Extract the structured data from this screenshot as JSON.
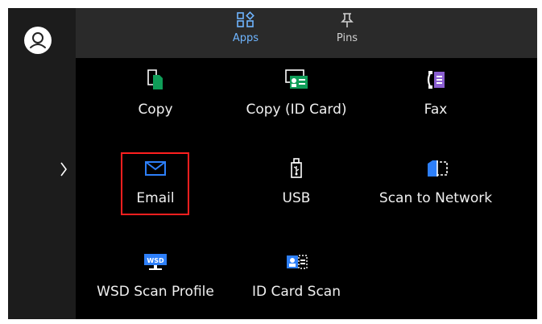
{
  "header": {
    "tabs": [
      {
        "label": "Apps",
        "icon": "grid-apps-icon"
      },
      {
        "label": "Pins",
        "icon": "pin-icon"
      }
    ]
  },
  "sidebar": {
    "user_icon": "user-icon",
    "expand_icon": "chevron-right-icon"
  },
  "apps": [
    {
      "label": "Copy",
      "icon": "copy-icon"
    },
    {
      "label": "Copy (ID Card)",
      "icon": "id-card-copy-icon"
    },
    {
      "label": "Fax",
      "icon": "fax-icon"
    },
    {
      "label": "Email",
      "icon": "email-icon"
    },
    {
      "label": "USB",
      "icon": "usb-icon"
    },
    {
      "label": "Scan to Network",
      "icon": "scan-to-network-icon"
    },
    {
      "label": "WSD Scan Profile",
      "icon": "wsd-icon"
    },
    {
      "label": "ID Card Scan",
      "icon": "id-card-scan-icon"
    }
  ],
  "colors": {
    "accent": "#6fb5ff",
    "highlight": "#ff1f1f",
    "icon_green": "#0f9d58",
    "icon_purple": "#8b5fd1",
    "icon_blue": "#2d7ff9"
  }
}
